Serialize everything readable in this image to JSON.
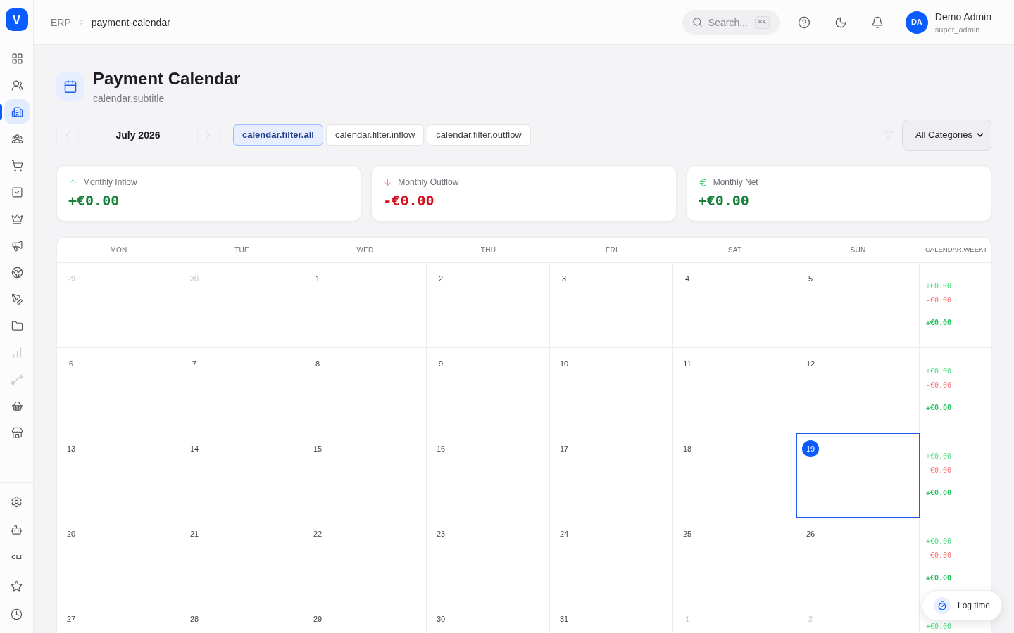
{
  "sidebar": {
    "logo": "V",
    "items": [
      {
        "selected": false,
        "disabled": false
      },
      {
        "selected": false,
        "disabled": false
      },
      {
        "selected": true,
        "disabled": false
      },
      {
        "selected": false,
        "disabled": false
      },
      {
        "selected": false,
        "disabled": false
      },
      {
        "selected": false,
        "disabled": false
      },
      {
        "selected": false,
        "disabled": false
      },
      {
        "selected": false,
        "disabled": false
      },
      {
        "selected": false,
        "disabled": false
      },
      {
        "selected": false,
        "disabled": false
      },
      {
        "selected": false,
        "disabled": false
      },
      {
        "selected": false,
        "disabled": true
      },
      {
        "selected": false,
        "disabled": true
      },
      {
        "selected": false,
        "disabled": false
      },
      {
        "selected": false,
        "disabled": false
      }
    ],
    "bottom_items": [
      {
        "kind": "icon"
      },
      {
        "kind": "icon"
      },
      {
        "kind": "text",
        "label": "CLI"
      },
      {
        "kind": "icon"
      },
      {
        "kind": "icon"
      }
    ]
  },
  "header": {
    "breadcrumb": [
      "ERP",
      "payment-calendar"
    ],
    "search": {
      "placeholder": "Search...",
      "shortcut": "⌘K"
    },
    "user": {
      "initials": "DA",
      "name": "Demo Admin",
      "role": "super_admin"
    }
  },
  "page": {
    "title": "Payment Calendar",
    "subtitle": "calendar.subtitle"
  },
  "toolbar": {
    "month": "July 2026",
    "filters": [
      {
        "label": "calendar.filter.all",
        "selected": true
      },
      {
        "label": "calendar.filter.inflow",
        "selected": false
      },
      {
        "label": "calendar.filter.outflow",
        "selected": false
      }
    ],
    "category_select": {
      "value": "All Categories"
    }
  },
  "stats": [
    {
      "kind": "inflow",
      "label": "Monthly Inflow",
      "value": "+€0.00"
    },
    {
      "kind": "outflow",
      "label": "Monthly Outflow",
      "value": "-€0.00"
    },
    {
      "kind": "net",
      "label": "Monthly Net",
      "value": "+€0.00"
    }
  ],
  "calendar": {
    "columns": [
      "MON",
      "TUE",
      "WED",
      "THU",
      "FRI",
      "SAT",
      "SUN",
      "CALENDAR.WEEKT"
    ],
    "weeks": [
      {
        "days": [
          {
            "label": "29",
            "in_month": false,
            "today": false
          },
          {
            "label": "30",
            "in_month": false,
            "today": false
          },
          {
            "label": "1",
            "in_month": true,
            "today": false
          },
          {
            "label": "2",
            "in_month": true,
            "today": false
          },
          {
            "label": "3",
            "in_month": true,
            "today": false
          },
          {
            "label": "4",
            "in_month": true,
            "today": false
          },
          {
            "label": "5",
            "in_month": true,
            "today": false
          }
        ],
        "totals": {
          "inflow": "+€0.00",
          "outflow": "-€0.00",
          "net": "+€0.00"
        }
      },
      {
        "days": [
          {
            "label": "6",
            "in_month": true,
            "today": false
          },
          {
            "label": "7",
            "in_month": true,
            "today": false
          },
          {
            "label": "8",
            "in_month": true,
            "today": false
          },
          {
            "label": "9",
            "in_month": true,
            "today": false
          },
          {
            "label": "10",
            "in_month": true,
            "today": false
          },
          {
            "label": "11",
            "in_month": true,
            "today": false
          },
          {
            "label": "12",
            "in_month": true,
            "today": false
          }
        ],
        "totals": {
          "inflow": "+€0.00",
          "outflow": "-€0.00",
          "net": "+€0.00"
        }
      },
      {
        "days": [
          {
            "label": "13",
            "in_month": true,
            "today": false
          },
          {
            "label": "14",
            "in_month": true,
            "today": false
          },
          {
            "label": "15",
            "in_month": true,
            "today": false
          },
          {
            "label": "16",
            "in_month": true,
            "today": false
          },
          {
            "label": "17",
            "in_month": true,
            "today": false
          },
          {
            "label": "18",
            "in_month": true,
            "today": false
          },
          {
            "label": "19",
            "in_month": true,
            "today": true
          }
        ],
        "totals": {
          "inflow": "+€0.00",
          "outflow": "-€0.00",
          "net": "+€0.00"
        }
      },
      {
        "days": [
          {
            "label": "20",
            "in_month": true,
            "today": false
          },
          {
            "label": "21",
            "in_month": true,
            "today": false
          },
          {
            "label": "22",
            "in_month": true,
            "today": false
          },
          {
            "label": "23",
            "in_month": true,
            "today": false
          },
          {
            "label": "24",
            "in_month": true,
            "today": false
          },
          {
            "label": "25",
            "in_month": true,
            "today": false
          },
          {
            "label": "26",
            "in_month": true,
            "today": false
          }
        ],
        "totals": {
          "inflow": "+€0.00",
          "outflow": "-€0.00",
          "net": "+€0.00"
        }
      },
      {
        "days": [
          {
            "label": "27",
            "in_month": true,
            "today": false
          },
          {
            "label": "28",
            "in_month": true,
            "today": false
          },
          {
            "label": "29",
            "in_month": true,
            "today": false
          },
          {
            "label": "30",
            "in_month": true,
            "today": false
          },
          {
            "label": "31",
            "in_month": true,
            "today": false
          },
          {
            "label": "1",
            "in_month": false,
            "today": false
          },
          {
            "label": "2",
            "in_month": false,
            "today": false
          }
        ],
        "totals": {
          "inflow": "+€0.00"
        }
      }
    ]
  },
  "log_time_button": {
    "label": "Log time"
  }
}
